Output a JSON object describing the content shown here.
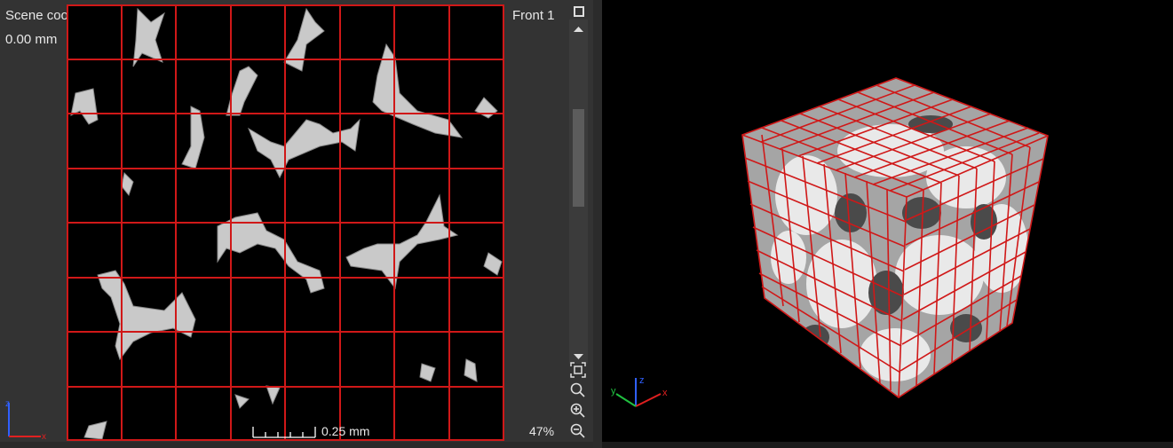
{
  "left_view": {
    "coordinate_system_label": "Scene coordinate system",
    "slice_position": "0.00 mm",
    "view_name": "Front 1",
    "scale_bar_label": "0.25 mm",
    "zoom_level": "47%",
    "scroll_position": 0.35
  },
  "tools": {
    "icons": [
      "maximize-icon",
      "fit-view-icon",
      "zoom-icon",
      "zoom-in-icon",
      "zoom-out-icon"
    ]
  },
  "colors": {
    "grid": "#d01818",
    "panel_bg": "#333333",
    "axis_x": "#e02020",
    "axis_y": "#20c040",
    "axis_z": "#3060ff"
  },
  "axes_labels": {
    "x": "x",
    "y": "y",
    "z": "z"
  }
}
